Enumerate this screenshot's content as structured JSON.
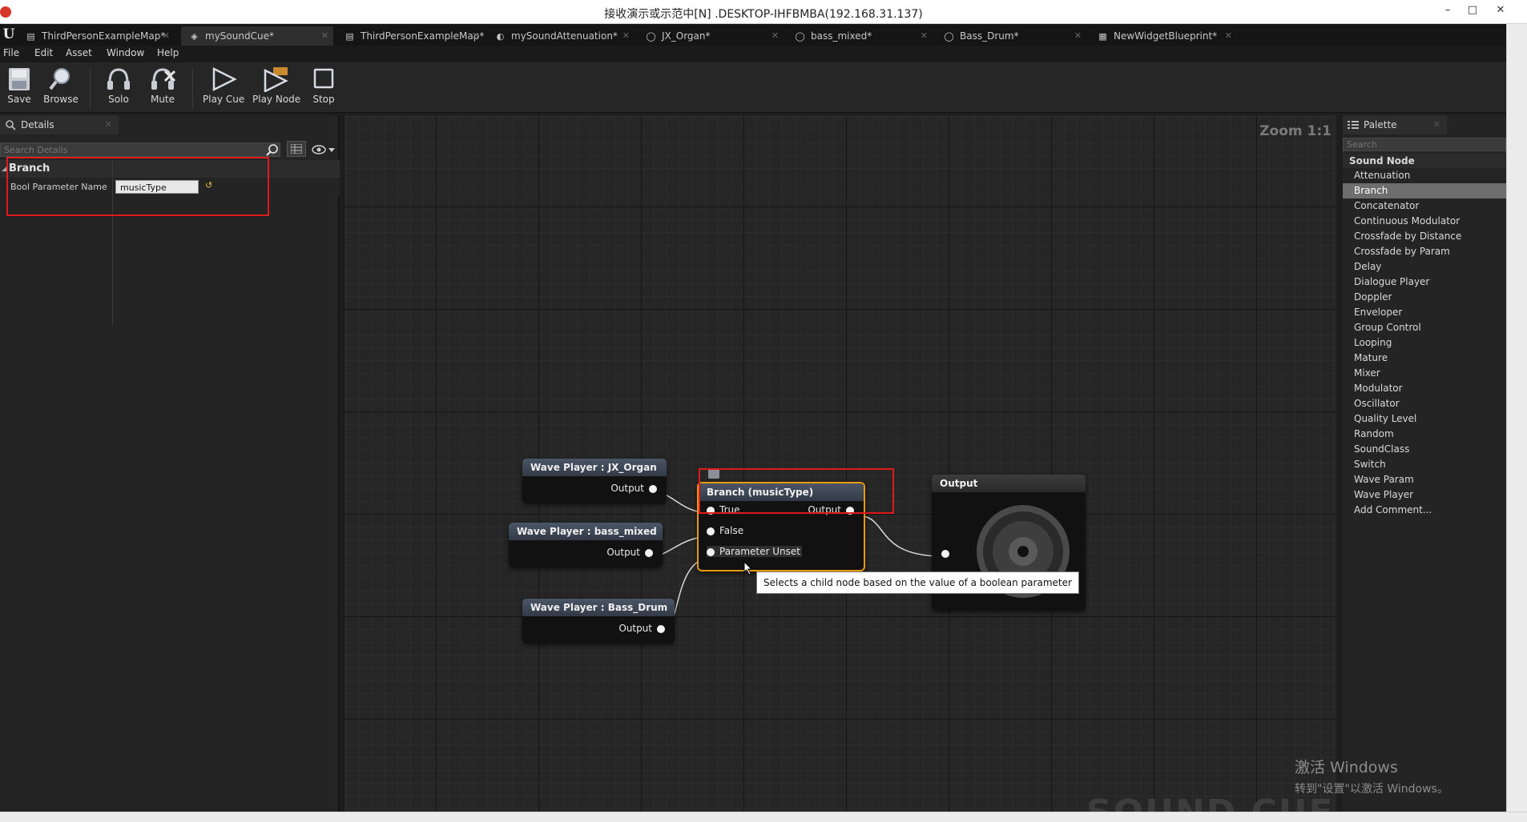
{
  "window": {
    "title": "接收演示或示范中[N] .DESKTOP-IHFBMBA(192.168.31.137)",
    "controls": {
      "minimize": "–",
      "maximize": "□",
      "close": "✕"
    }
  },
  "tabs": [
    {
      "label": "ThirdPersonExampleMap*",
      "icon": "map-icon",
      "active": false
    },
    {
      "label": "mySoundCue*",
      "icon": "sound-cue-icon",
      "active": true
    },
    {
      "label": "ThirdPersonExampleMap*",
      "icon": "map-icon",
      "active": false
    },
    {
      "label": "mySoundAttenuation*",
      "icon": "attenuation-icon",
      "active": false
    },
    {
      "label": "JX_Organ*",
      "icon": "sound-wave-icon",
      "active": false
    },
    {
      "label": "bass_mixed*",
      "icon": "sound-wave-icon",
      "active": false
    },
    {
      "label": "Bass_Drum*",
      "icon": "sound-wave-icon",
      "active": false
    },
    {
      "label": "NewWidgetBlueprint*",
      "icon": "widget-icon",
      "active": false
    }
  ],
  "menu": [
    "File",
    "Edit",
    "Asset",
    "Window",
    "Help"
  ],
  "toolbar": {
    "save": "Save",
    "browse": "Browse",
    "solo": "Solo",
    "mute": "Mute",
    "play_cue": "Play Cue",
    "play_node": "Play Node",
    "stop": "Stop"
  },
  "details": {
    "tab": "Details",
    "search_placeholder": "Search Details",
    "category": "Branch",
    "property_name": "Bool Parameter Name",
    "property_value": "musicType"
  },
  "graph": {
    "zoom": "Zoom 1:1",
    "watermark": "SOUND CUE",
    "nodes": {
      "wave_organ": {
        "title": "Wave Player : JX_Organ",
        "output": "Output"
      },
      "wave_bass_mixed": {
        "title": "Wave Player : bass_mixed",
        "output": "Output"
      },
      "wave_bass_drum": {
        "title": "Wave Player : Bass_Drum",
        "output": "Output"
      },
      "branch": {
        "title": "Branch (musicType)",
        "pin_true": "True",
        "pin_false": "False",
        "pin_unset": "Parameter Unset",
        "output": "Output"
      },
      "output": {
        "title": "Output"
      }
    },
    "tooltip": "Selects a child node based on the value of a boolean parameter"
  },
  "palette": {
    "tab": "Palette",
    "search_placeholder": "Search",
    "category": "Sound Node",
    "selected": "Branch",
    "items": [
      "Attenuation",
      "Branch",
      "Concatenator",
      "Continuous Modulator",
      "Crossfade by Distance",
      "Crossfade by Param",
      "Delay",
      "Dialogue Player",
      "Doppler",
      "Enveloper",
      "Group Control",
      "Looping",
      "Mature",
      "Mixer",
      "Modulator",
      "Oscillator",
      "Quality Level",
      "Random",
      "SoundClass",
      "Switch",
      "Wave Param",
      "Wave Player",
      "Add Comment..."
    ]
  },
  "activation": {
    "line1": "激活 Windows",
    "line2": "转到\"设置\"以激活 Windows。"
  },
  "colors": {
    "highlight_box": "#e01a1a",
    "branch_selected_border": "#e69a10",
    "graph_background": "#262626"
  }
}
